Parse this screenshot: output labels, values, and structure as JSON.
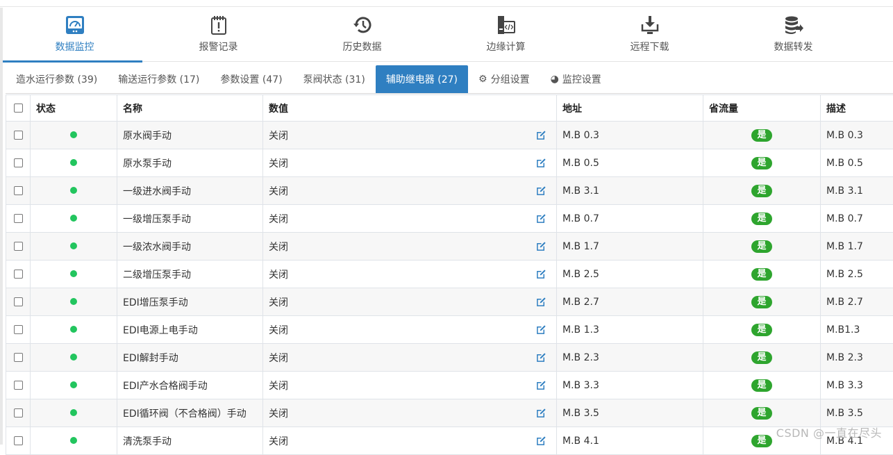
{
  "nav": [
    {
      "label": "数据监控",
      "icon": "dashboard-icon",
      "active": true
    },
    {
      "label": "报警记录",
      "icon": "alarm-icon",
      "active": false
    },
    {
      "label": "历史数据",
      "icon": "history-icon",
      "active": false
    },
    {
      "label": "边缘计算",
      "icon": "code-icon",
      "active": false
    },
    {
      "label": "远程下载",
      "icon": "download-icon",
      "active": false
    },
    {
      "label": "数据转发",
      "icon": "database-forward-icon",
      "active": false
    }
  ],
  "tabs": [
    {
      "label": "造水运行参数 (39)"
    },
    {
      "label": "输送运行参数 (17)"
    },
    {
      "label": "参数设置 (47)"
    },
    {
      "label": "泵阀状态 (31)"
    },
    {
      "label": "辅助继电器 (27)",
      "active": true
    },
    {
      "label": "分组设置",
      "icon": "gear-icon"
    },
    {
      "label": "监控设置",
      "icon": "globe-icon"
    }
  ],
  "table": {
    "headers": [
      "状态",
      "名称",
      "数值",
      "地址",
      "省流量",
      "描述"
    ],
    "rows": [
      {
        "name": "原水阀手动",
        "value": "关闭",
        "address": "M.B 0.3",
        "save": "是",
        "desc": "M.B 0.3"
      },
      {
        "name": "原水泵手动",
        "value": "关闭",
        "address": "M.B 0.5",
        "save": "是",
        "desc": "M.B 0.5"
      },
      {
        "name": "一级进水阀手动",
        "value": "关闭",
        "address": "M.B 3.1",
        "save": "是",
        "desc": "M.B 3.1"
      },
      {
        "name": "一级增压泵手动",
        "value": "关闭",
        "address": "M.B 0.7",
        "save": "是",
        "desc": "M.B 0.7"
      },
      {
        "name": "一级浓水阀手动",
        "value": "关闭",
        "address": "M.B 1.7",
        "save": "是",
        "desc": "M.B 1.7"
      },
      {
        "name": "二级增压泵手动",
        "value": "关闭",
        "address": "M.B 2.5",
        "save": "是",
        "desc": "M.B 2.5"
      },
      {
        "name": "EDI增压泵手动",
        "value": "关闭",
        "address": "M.B 2.7",
        "save": "是",
        "desc": "M.B 2.7"
      },
      {
        "name": "EDI电源上电手动",
        "value": "关闭",
        "address": "M.B 1.3",
        "save": "是",
        "desc": "M.B1.3"
      },
      {
        "name": "EDI解封手动",
        "value": "关闭",
        "address": "M.B 2.3",
        "save": "是",
        "desc": "M.B 2.3"
      },
      {
        "name": "EDI产水合格阀手动",
        "value": "关闭",
        "address": "M.B 3.3",
        "save": "是",
        "desc": "M.B 3.3"
      },
      {
        "name": "EDI循环阀（不合格阀）手动",
        "value": "关闭",
        "address": "M.B 3.5",
        "save": "是",
        "desc": "M.B 3.5"
      },
      {
        "name": "清洗泵手动",
        "value": "关闭",
        "address": "M.B 4.1",
        "save": "是",
        "desc": "M.B 4.1"
      }
    ]
  },
  "status_color": "#22c55e",
  "accent_color": "#2f7fc1",
  "watermark": "CSDN @一直在尽头"
}
